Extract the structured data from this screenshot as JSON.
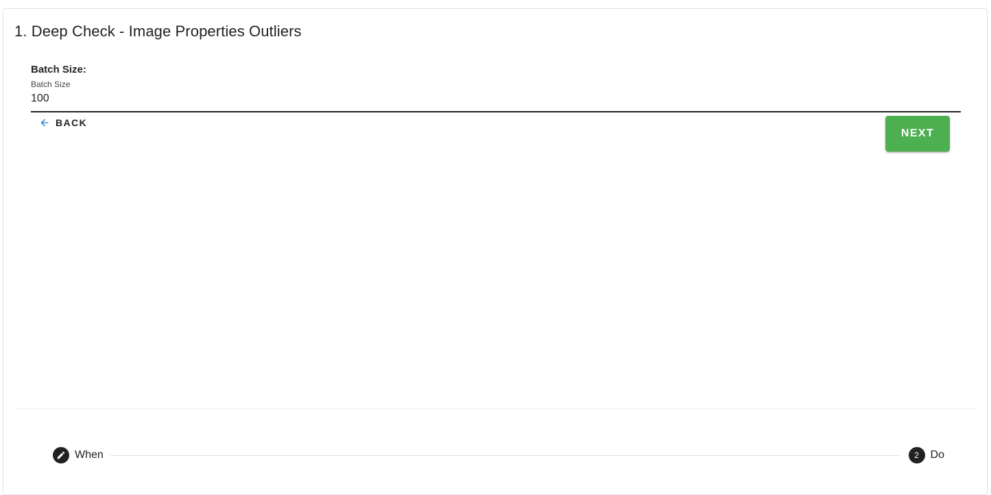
{
  "page": {
    "title": "1. Deep Check - Image Properties Outliers"
  },
  "form": {
    "heading": "Batch Size:",
    "batch_size": {
      "label": "Batch Size",
      "value": "100"
    }
  },
  "actions": {
    "back_label": "BACK",
    "back_icon": "arrow-left-icon",
    "next_label": "NEXT",
    "next_color": "#4caf50",
    "back_icon_color": "#1976d2"
  },
  "stepper": {
    "steps": [
      {
        "label": "When",
        "icon": "pencil-icon",
        "state": "completed"
      },
      {
        "label": "Do",
        "number": "2",
        "state": "active"
      }
    ]
  }
}
